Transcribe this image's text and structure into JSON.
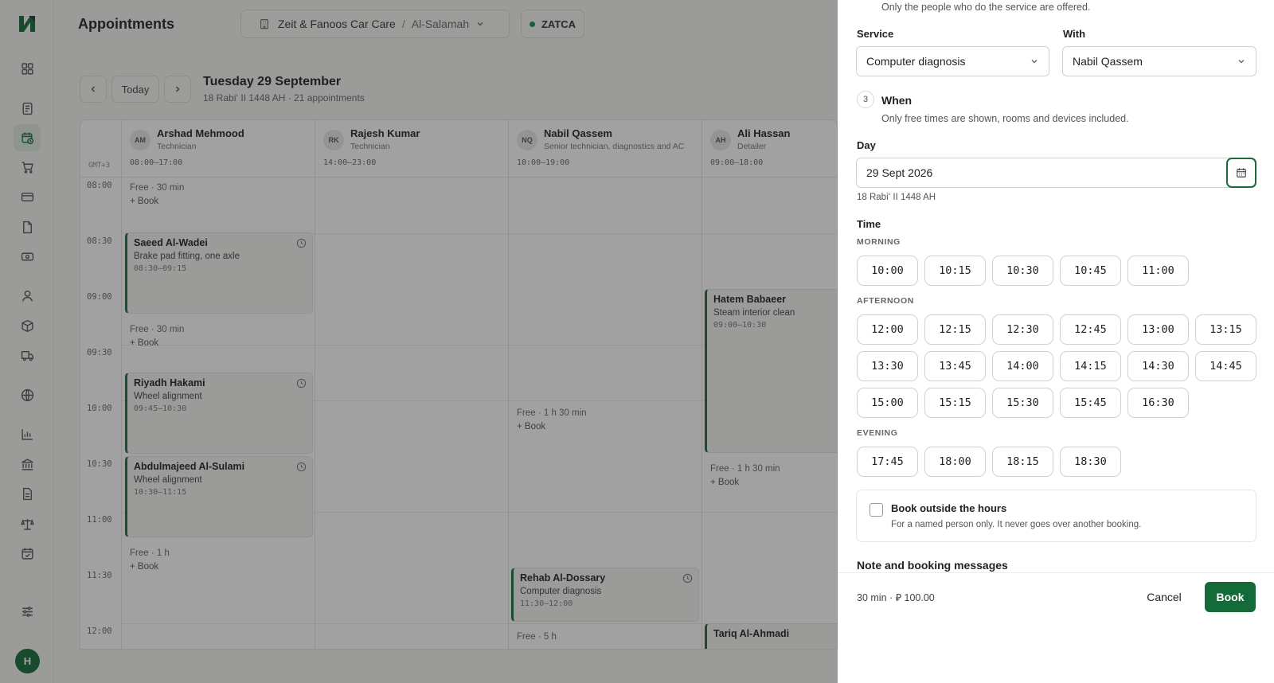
{
  "app": {
    "avatar_initial": "H"
  },
  "header": {
    "title": "Appointments",
    "business": "Zeit & Fanoos Car Care",
    "branch": "Al-Salamah",
    "separator": "/",
    "zatca": "ZATCA"
  },
  "datebar": {
    "today": "Today",
    "date": "Tuesday 29 September",
    "sub": "18 Rabiʻ II 1448 AH · 21 appointments"
  },
  "calendar": {
    "timezone": "GMT+3",
    "times": [
      "08:00",
      "08:30",
      "09:00",
      "09:30",
      "10:00",
      "10:30",
      "11:00",
      "11:30",
      "12:00"
    ],
    "staff": [
      {
        "initials": "AM",
        "name": "Arshad Mehmood",
        "role": "Technician",
        "hours": "08:00–17:00"
      },
      {
        "initials": "RK",
        "name": "Rajesh Kumar",
        "role": "Technician",
        "hours": "14:00–23:00"
      },
      {
        "initials": "NQ",
        "name": "Nabil Qassem",
        "role": "Senior technician, diagnostics and AC",
        "hours": "10:00–19:00"
      },
      {
        "initials": "AH",
        "name": "Ali Hassan",
        "role": "Detailer",
        "hours": "09:00–18:00"
      }
    ],
    "free": [
      {
        "label": "Free · 30 min",
        "book": "+ Book"
      },
      {
        "label": "Free · 30 min",
        "book": "+ Book"
      },
      {
        "label": "Free · 1 h",
        "book": "+ Book"
      },
      {
        "label": "Free · 1 h 30 min",
        "book": "+ Book"
      },
      {
        "label": "Free · 5 h"
      },
      {
        "label": "Free · 1 h 30 min",
        "book": "+ Book"
      }
    ],
    "appointments": [
      {
        "name": "Saeed Al-Wadei",
        "service": "Brake pad fitting, one axle",
        "time": "08:30–09:15"
      },
      {
        "name": "Riyadh Hakami",
        "service": "Wheel alignment",
        "time": "09:45–10:30"
      },
      {
        "name": "Abdulmajeed Al-Sulami",
        "service": "Wheel alignment",
        "time": "10:30–11:15"
      },
      {
        "name": "Rehab Al-Dossary",
        "service": "Computer diagnosis",
        "time": "11:30–12:00"
      },
      {
        "name": "Hatem Babaeer",
        "service": "Steam interior clean",
        "time": "09:00–10:30"
      },
      {
        "name": "Tariq Al-Ahmadi"
      }
    ]
  },
  "drawer": {
    "intro": "Only the people who do the service are offered.",
    "service_label": "Service",
    "service_value": "Computer diagnosis",
    "with_label": "With",
    "with_value": "Nabil Qassem",
    "step": "3",
    "when_title": "When",
    "when_sub": "Only free times are shown, rooms and devices included.",
    "day_label": "Day",
    "day_value": "29 Sept 2026",
    "day_hijri": "18 Rabiʻ II 1448 AH",
    "time_label": "Time",
    "morning_label": "MORNING",
    "morning": [
      "10:00",
      "10:15",
      "10:30",
      "10:45",
      "11:00"
    ],
    "afternoon_label": "AFTERNOON",
    "afternoon": [
      "12:00",
      "12:15",
      "12:30",
      "12:45",
      "13:00",
      "13:15",
      "13:30",
      "13:45",
      "14:00",
      "14:15",
      "14:30",
      "14:45",
      "15:00",
      "15:15",
      "15:30",
      "15:45",
      "16:30"
    ],
    "evening_label": "EVENING",
    "evening": [
      "17:45",
      "18:00",
      "18:15",
      "18:30"
    ],
    "outside_title": "Book outside the hours",
    "outside_sub": "For a named person only. It never goes over another booking.",
    "note_title": "Note and booking messages",
    "summary": "30 min · ⃁ 100.00",
    "cancel": "Cancel",
    "book": "Book"
  },
  "colors": {
    "accent": "#146b3a",
    "appointment_bar": "#1a6b3c"
  }
}
